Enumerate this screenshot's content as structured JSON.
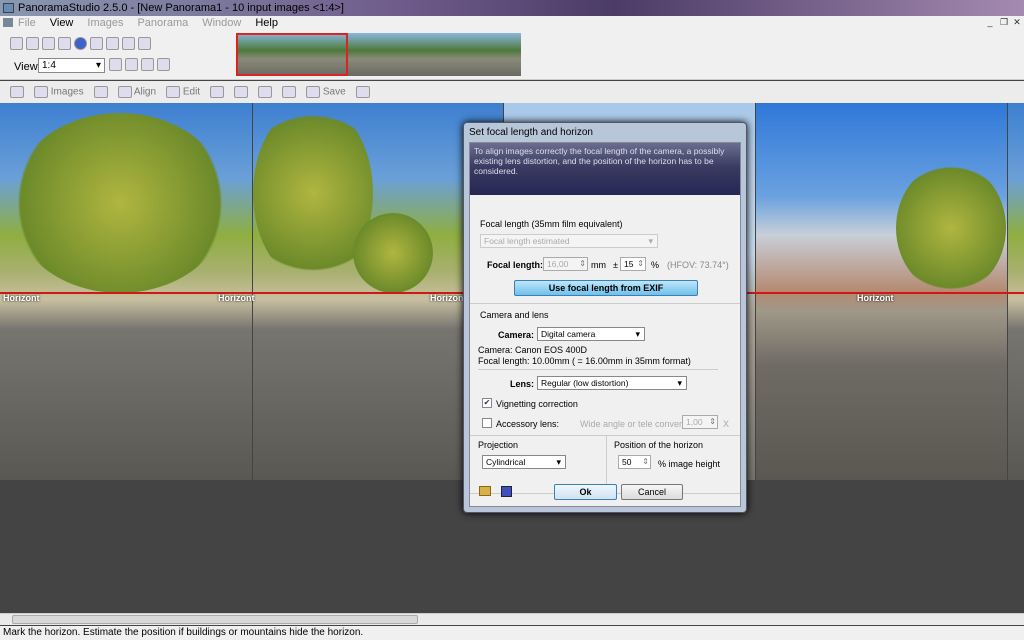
{
  "window": {
    "title": "PanoramaStudio 2.5.0 - [New Panorama1 - 10 input images <1:4>]"
  },
  "menu": [
    {
      "label": "File",
      "enabled": false
    },
    {
      "label": "View",
      "enabled": true
    },
    {
      "label": "Images",
      "enabled": false
    },
    {
      "label": "Panorama",
      "enabled": false
    },
    {
      "label": "Window",
      "enabled": false
    },
    {
      "label": "Help",
      "enabled": true
    }
  ],
  "view": {
    "label": "View:",
    "zoom": "1:4"
  },
  "toolbar2": {
    "images": "Images",
    "align": "Align",
    "edit": "Edit",
    "save": "Save"
  },
  "canvas": {
    "horizon_label": "Horizont",
    "horizon_color": "#d01818"
  },
  "dialog": {
    "title": "Set focal length and horizon",
    "intro": "To align images correctly the focal length of the camera, a possibly existing lens distortion, and the position of the horizon has to be considered.",
    "focal_section": "Focal length (35mm film equivalent)",
    "focal_mode": "Focal length estimated",
    "focal_label": "Focal length:",
    "focal_value": "16,00",
    "focal_unit": "mm",
    "tolerance_sign": "±",
    "tolerance": "15",
    "tolerance_unit": "%",
    "hfov": "(HFOV: 73.74°)",
    "exif_button": "Use focal length from EXIF",
    "camera_section": "Camera and lens",
    "camera_label": "Camera:",
    "camera_value": "Digital camera",
    "camera_info": "Camera: Canon EOS 400D",
    "focal_info": "Focal length: 10.00mm ( = 16.00mm in 35mm format)",
    "lens_label": "Lens:",
    "lens_value": "Regular  (low distortion)",
    "vignetting_label": "Vignetting correction",
    "vignetting_checked": true,
    "accessory_label": "Accessory lens:",
    "accessory_checked": false,
    "converter_label": "Wide angle or tele converter",
    "converter_value": "1,00",
    "converter_unit": "X",
    "projection_label": "Projection",
    "projection_value": "Cylindrical",
    "horizon_label": "Position of the horizon",
    "horizon_value": "50",
    "horizon_unit": "% image height",
    "ok": "Ok",
    "cancel": "Cancel"
  },
  "status": "Mark the horizon. Estimate the position if buildings or mountains hide the horizon."
}
